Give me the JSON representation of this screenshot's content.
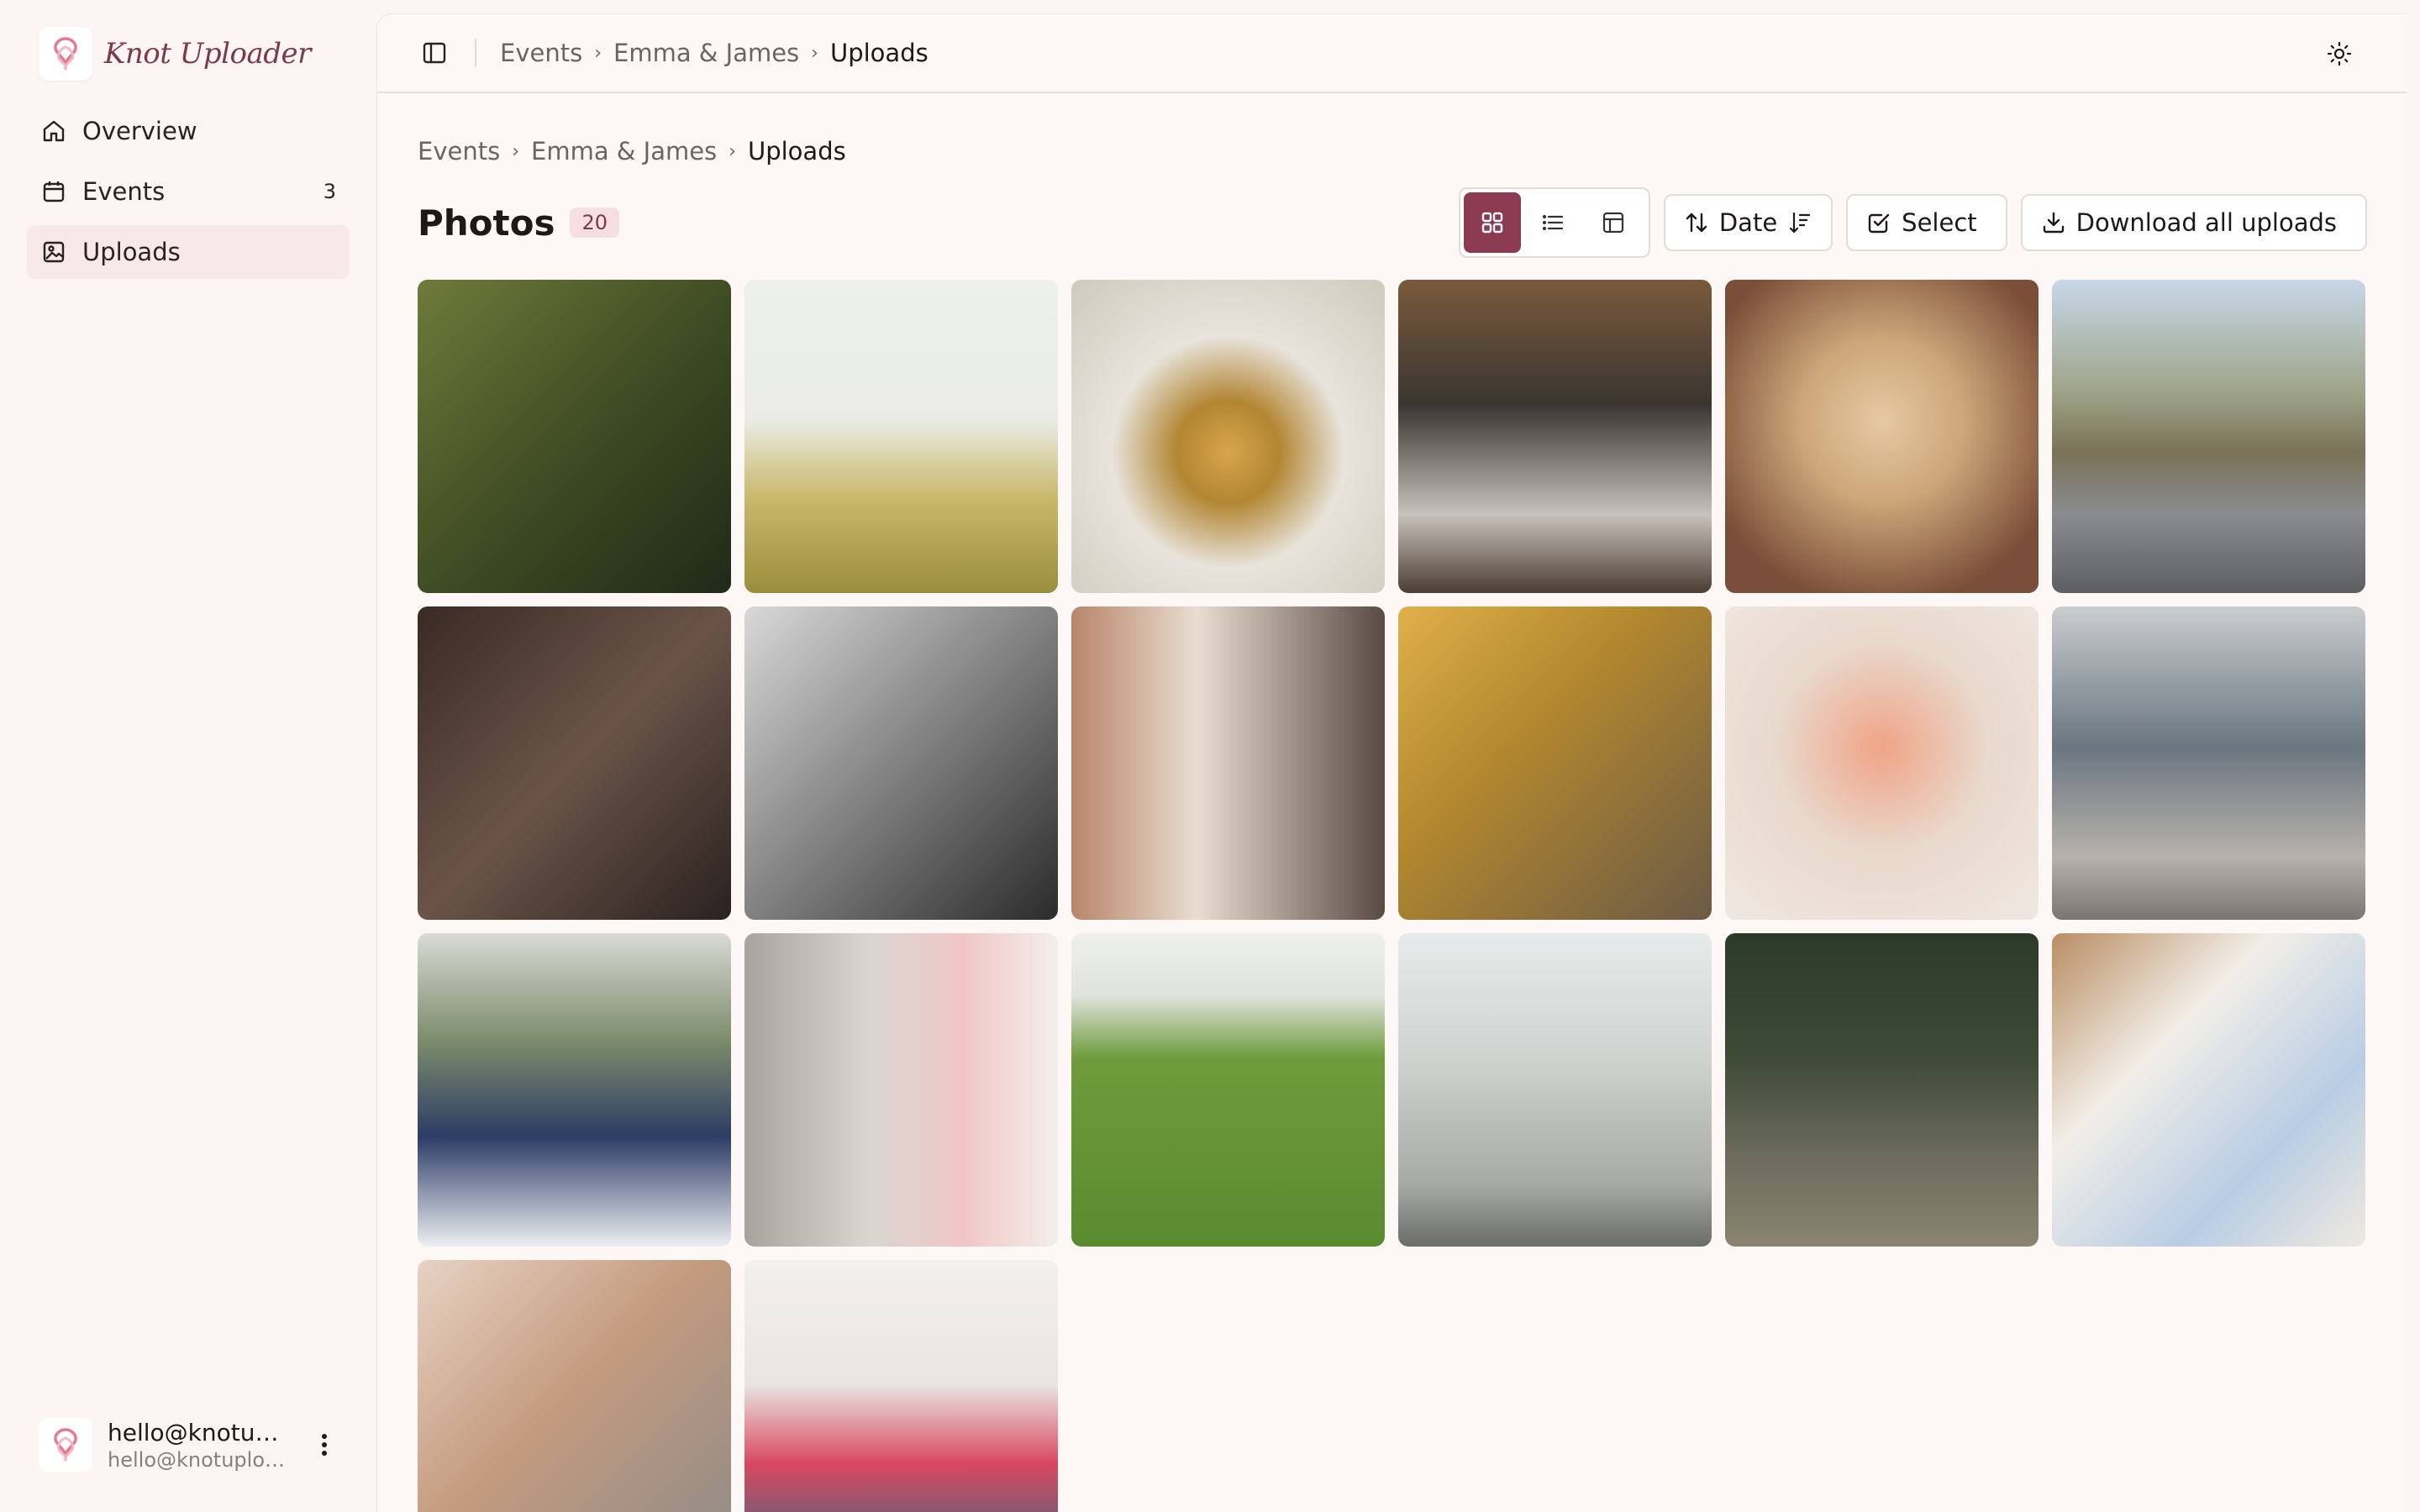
{
  "app": {
    "name": "Knot Uploader"
  },
  "sidebar": {
    "items": [
      {
        "label": "Overview",
        "icon": "home-icon"
      },
      {
        "label": "Events",
        "icon": "calendar-icon",
        "count": "3"
      },
      {
        "label": "Uploads",
        "icon": "image-icon",
        "active": true
      }
    ],
    "user": {
      "name": "hello@knotupl...",
      "email": "hello@knotuploa..."
    }
  },
  "topbar": {
    "breadcrumb": [
      "Events",
      "Emma & James",
      "Uploads"
    ]
  },
  "page": {
    "breadcrumb": [
      "Events",
      "Emma & James",
      "Uploads"
    ],
    "title": "Photos",
    "count": "20",
    "views": [
      "grid-view-icon",
      "list-view-icon",
      "table-view-icon"
    ],
    "active_view": "grid",
    "sort_label": "Date",
    "select_label": "Select",
    "download_label": "Download all uploads"
  },
  "colors": {
    "accent": "#8b3a52",
    "brand": "#7a3a4c",
    "background": "#fcf5f3"
  },
  "photos": [
    {
      "subject": "holding-hands-shadow",
      "bg": "linear-gradient(135deg,#6f7a3a 0%,#3b4a22 55%,#1f2a18 100%)"
    },
    {
      "subject": "poppy-field",
      "bg": "linear-gradient(180deg,#eef0ec 0%,#e9ebe4 45%,#c9b86a 70%,#9a8e3c 100%)"
    },
    {
      "subject": "wedding-rings",
      "bg": "radial-gradient(circle at 50% 55%,#d8a64a 0%,#b38633 22%,#e8e4dc 50%,#cfc9bd 100%)"
    },
    {
      "subject": "couple-exit-chapel",
      "bg": "linear-gradient(180deg,#7a5a3c 0%,#3a3530 40%,#c8c2bc 75%,#4a3d33 100%)"
    },
    {
      "subject": "golden-puppy",
      "bg": "radial-gradient(circle at 50% 45%,#e6c9a3 0%,#cda67a 35%,#7a4e38 80%)"
    },
    {
      "subject": "bride-on-road",
      "bg": "linear-gradient(180deg,#c7d7ea 0%,#9fa68a 35%,#7a7258 55%,#8a8c90 75%,#5c5e62 100%)"
    },
    {
      "subject": "champagne-toast",
      "bg": "linear-gradient(135deg,#3a2a24 0%,#6a5448 50%,#2a2220 100%)"
    },
    {
      "subject": "black-white-kiss",
      "bg": "linear-gradient(135deg,#d9d9d9 0%,#8a8a8a 45%,#2b2b2b 100%)"
    },
    {
      "subject": "bouquet-couple",
      "bg": "linear-gradient(90deg,#b9856a 0%,#e8ddd0 40%,#5a4a44 100%)"
    },
    {
      "subject": "couple-autumn",
      "bg": "linear-gradient(135deg,#e0b04a 0%,#b2872e 40%,#6b5a46 100%)"
    },
    {
      "subject": "peach-rose-bouquet",
      "bg": "radial-gradient(circle at 50% 45%,#f0a486 0%,#e9d8cc 45%,#efe8e2 100%)"
    },
    {
      "subject": "couple-beach-veil",
      "bg": "linear-gradient(180deg,#c9cdd0 0%,#6b7680 45%,#b7b2ac 80%,#7c7470 100%)"
    },
    {
      "subject": "confetti-kiss",
      "bg": "linear-gradient(180deg,#d8dbd5 0%,#7a8a6a 35%,#2c3c66 65%,#eceff2 100%)"
    },
    {
      "subject": "bride-pink-bouquet",
      "bg": "linear-gradient(90deg,#a7a49e 0%,#d9d6d0 40%,#f1c6c8 70%,#f3efe9 100%)"
    },
    {
      "subject": "chairs-on-lawn",
      "bg": "linear-gradient(180deg,#eef0ee 0%,#dfe3dc 20%,#6f9b3c 40%,#5a8a2f 100%)"
    },
    {
      "subject": "dress-in-window",
      "bg": "linear-gradient(180deg,#e6eaea 0%,#cfd3d0 40%,#a7aaa5 80%,#6a6d6a 100%)"
    },
    {
      "subject": "couple-palm-trees",
      "bg": "linear-gradient(180deg,#2c3a2a 0%,#3f4a38 40%,#6b6a5c 70%,#8a8470 100%)"
    },
    {
      "subject": "table-setting",
      "bg": "linear-gradient(135deg,#b98d62 0%,#f2eee8 35%,#b8cde4 70%,#efe9df 100%)"
    },
    {
      "subject": "hands-rings-watch",
      "bg": "linear-gradient(135deg,#e7d2c3 0%,#c49b7e 45%,#8d8a88 100%)"
    },
    {
      "subject": "balloons-pool",
      "bg": "linear-gradient(180deg,#f2f0ee 0%,#e8e4e2 40%,#d84860 65%,#2a6a8a 100%)"
    }
  ]
}
